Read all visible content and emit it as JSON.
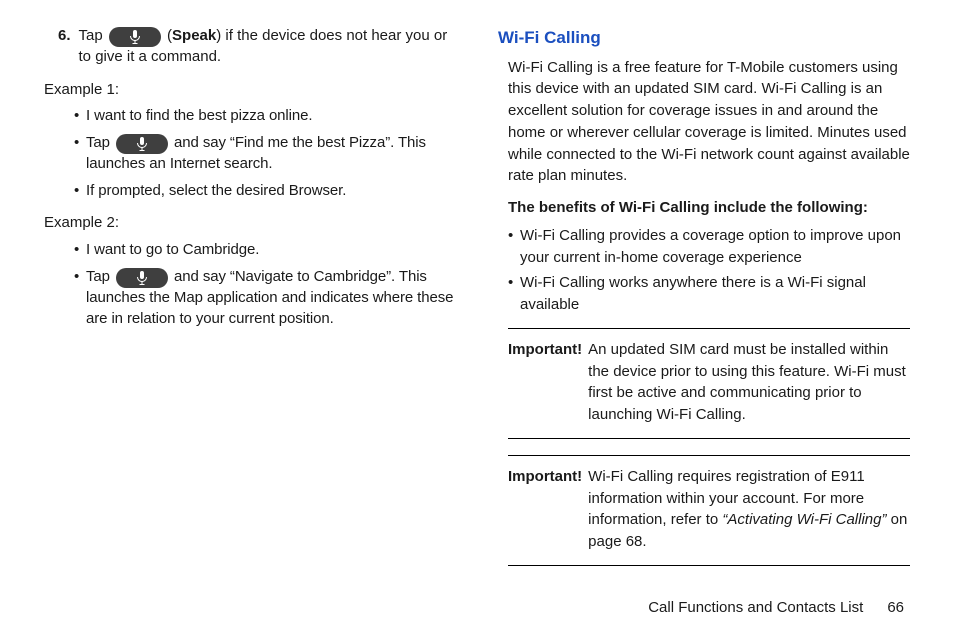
{
  "left": {
    "step_number": "6.",
    "step_text_a": "Tap ",
    "step_text_b": " (",
    "step_bold": "Speak",
    "step_text_c": ") if the device does not hear you or to give it a command.",
    "example1_label": "Example 1:",
    "ex1_b1": "I want to find the best pizza online.",
    "ex1_b2a": "Tap ",
    "ex1_b2b": " and say “Find me the best Pizza”. This launches an Internet search.",
    "ex1_b3": "If prompted, select the desired Browser.",
    "example2_label": "Example 2:",
    "ex2_b1": "I want to go to Cambridge.",
    "ex2_b2a": "Tap ",
    "ex2_b2b": " and say “Navigate to Cambridge”. This launches the Map application and indicates where these are in relation to your current position."
  },
  "right": {
    "heading": "Wi-Fi Calling",
    "intro": "Wi-Fi Calling is a free feature for T-Mobile customers using this device with an updated SIM card. Wi-Fi Calling is an excellent solution for coverage issues in and around the home or wherever cellular coverage is limited. Minutes used while connected to the Wi-Fi network count against available rate plan minutes.",
    "benefits_title": "The benefits of Wi-Fi Calling include the following:",
    "benefit1": "Wi-Fi Calling provides a coverage option to improve upon your current in-home coverage experience",
    "benefit2": "Wi-Fi Calling works anywhere there is a Wi-Fi signal available",
    "note1_label": "Important!",
    "note1_body": "An updated SIM card must be installed within the device prior to using this feature. Wi-Fi must first be active and communicating prior to launching Wi-Fi Calling.",
    "note2_label": "Important!",
    "note2_body_a": "Wi-Fi Calling requires registration of E911 information within your account. For more information, refer to ",
    "note2_ref": "“Activating Wi-Fi Calling”",
    "note2_body_b": "  on page 68."
  },
  "footer": {
    "text": "Call Functions and Contacts List",
    "page": "66"
  }
}
